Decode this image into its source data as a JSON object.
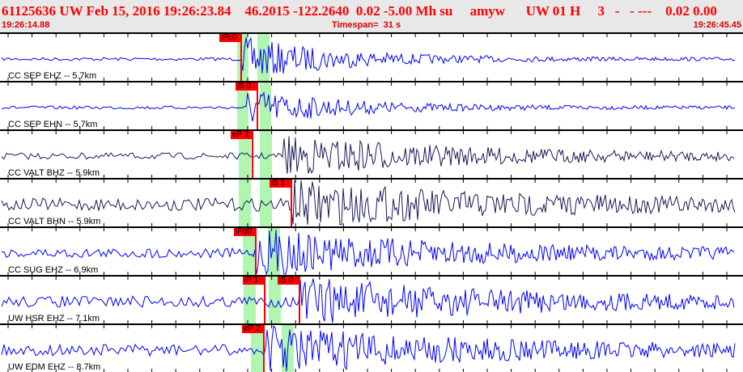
{
  "header": {
    "event_line": "61125636 UW Feb 15, 2016 19:26:23.84    46.2015 -122.2640  0.02 -5.00 Mh su     amyw      UW 01 H     3   -   - ---    0.02 0.00",
    "start_time": "19:26:14.88",
    "timespan": "Timespan=  31 s",
    "end_time": "19:26:45.45"
  },
  "colors": {
    "header": "#ff0000",
    "trace_blue": "#0000ff",
    "trace_dark": "#1a1a5a",
    "pick": "#ff0000",
    "window": "#b0f5b0"
  },
  "channels": [
    {
      "label": "CC SEP EHZ -- 5.7km",
      "picks": [
        "iPc0"
      ]
    },
    {
      "label": "CC SEP EHN -- 5.7km",
      "picks": [
        "iS 0"
      ]
    },
    {
      "label": "CC VALT BHZ -- 5.9km",
      "picks": [
        "eP 2"
      ]
    },
    {
      "label": "CC VALT BHN -- 5.9km",
      "picks": [
        "iS 1"
      ]
    },
    {
      "label": "CC SUG EHZ -- 6.9km",
      "picks": [
        "iPd0"
      ]
    },
    {
      "label": "UW HSR EHZ -- 7.1km",
      "picks": [
        "iP 1",
        "iS 0"
      ]
    },
    {
      "label": "UW EDM EHZ -- 8.7km",
      "picks": [
        "eP 2"
      ]
    }
  ]
}
